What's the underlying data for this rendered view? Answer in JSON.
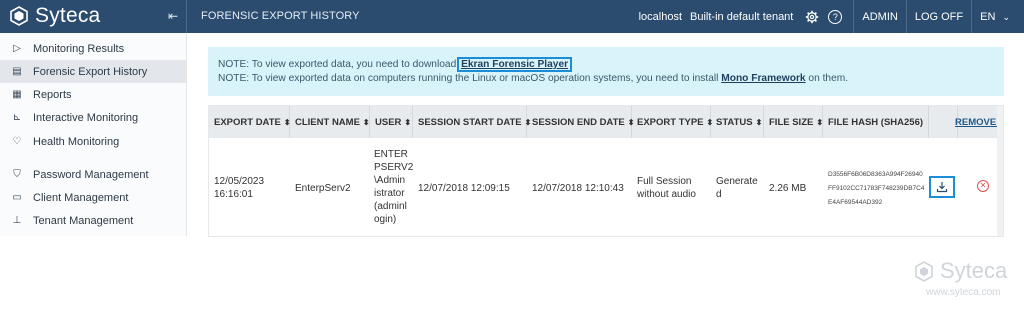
{
  "app": {
    "brand_name": "Syteca",
    "collapse_icon": "collapse-sidebar-icon"
  },
  "header": {
    "page_title": "FORENSIC EXPORT HISTORY",
    "host": "localhost",
    "tenant": "Built-in default tenant",
    "help_glyph": "?",
    "user": "ADMIN",
    "logoff": "LOG OFF",
    "language": "EN"
  },
  "sidebar": {
    "items": [
      {
        "label": "Monitoring Results",
        "icon": "play-icon",
        "glyph": "▷"
      },
      {
        "label": "Forensic Export History",
        "icon": "film-icon",
        "glyph": "▤",
        "active": true
      },
      {
        "label": "Reports",
        "icon": "report-icon",
        "glyph": "▦"
      },
      {
        "label": "Interactive Monitoring",
        "icon": "chart-icon",
        "glyph": "⊾"
      },
      {
        "label": "Health Monitoring",
        "icon": "heart-icon",
        "glyph": "♡"
      },
      {
        "label": "Password Management",
        "icon": "shield-icon",
        "glyph": "⛉"
      },
      {
        "label": "Client Management",
        "icon": "monitor-icon",
        "glyph": "▭"
      },
      {
        "label": "Tenant Management",
        "icon": "org-icon",
        "glyph": "⊥"
      }
    ]
  },
  "note": {
    "line1_prefix": "NOTE: To view exported data, you need to download",
    "line1_link": "Ekran Forensic Player",
    "line2_prefix": "NOTE: To view exported data on computers running the Linux or macOS operation systems, you need to install",
    "line2_link": "Mono Framework",
    "line2_suffix": "on them."
  },
  "table": {
    "headers": [
      "EXPORT DATE",
      "CLIENT NAME",
      "USER",
      "SESSION START DATE",
      "SESSION END DATE",
      "EXPORT TYPE",
      "STATUS",
      "FILE SIZE",
      "FILE HASH (SHA256)"
    ],
    "sort_glyph": "⬍",
    "remove_all": "REMOVE A",
    "row": {
      "export_date_l1": "12/05/2023",
      "export_date_l2": "16:16:01",
      "client_name": "EnterpServ2",
      "user_lines": [
        "ENTER",
        "PSERV2",
        "\\Admin",
        "istrator",
        "(adminl",
        "ogin)"
      ],
      "session_start": "12/07/2018 12:09:15",
      "session_end": "12/07/2018 12:10:43",
      "export_type_l1": "Full Session",
      "export_type_l2": "without audio",
      "status_l1": "Generate",
      "status_l2": "d",
      "file_size": "2.26 MB",
      "hash_l1": "D3556F6B06D8363A994F26940",
      "hash_l2": "FF9102CC71783F748239DB7C4",
      "hash_l3": "E4AF69544AD392",
      "download_icon": "download-icon",
      "delete_icon": "delete-icon"
    }
  },
  "watermark": {
    "name": "Syteca",
    "url": "www.syteca.com"
  }
}
